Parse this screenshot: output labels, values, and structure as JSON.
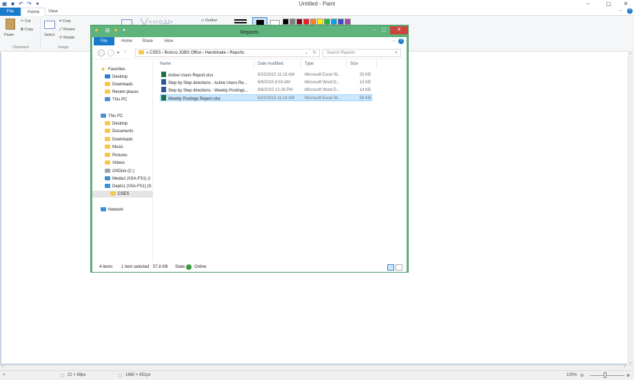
{
  "paint": {
    "title": "Untitled - Paint",
    "tabs": [
      "File",
      "Home",
      "View"
    ],
    "ribbon": {
      "paste": "Paste",
      "cut": "Cut",
      "copy": "Copy",
      "crop": "Crop",
      "resize": "Resize",
      "rotate": "Rotate",
      "select": "Select",
      "outline": "Outline",
      "groups": [
        "Clipboard",
        "Image"
      ]
    },
    "palette": [
      "#000000",
      "#7f7f7f",
      "#880015",
      "#ed1c24",
      "#ff7f27",
      "#fff200",
      "#22b14c",
      "#00a2e8",
      "#3f48cc",
      "#a349a4"
    ],
    "status": {
      "selection_size": "22 × 89px",
      "image_size": "1680 × 951px",
      "zoom": "100%"
    }
  },
  "explorer": {
    "title": "Reports",
    "tabs": [
      "File",
      "Home",
      "Share",
      "View"
    ],
    "address": "« CSES › Bronco JOBS Office › Handshake › Reports",
    "search_placeholder": "Search Reports",
    "nav": {
      "favorites": "Favorites",
      "fav_items": [
        "Desktop",
        "Downloads",
        "Recent places",
        "This PC"
      ],
      "thispc": "This PC",
      "pc_items": [
        "Desktop",
        "Documents",
        "Downloads",
        "Music",
        "Pictures",
        "Videos",
        "OSDisk (C:)",
        "Media1 (\\\\SA-FS1) (I",
        "Depts1 (\\\\SA-FS1) (S"
      ],
      "cses": "CSES",
      "network": "Network"
    },
    "columns": [
      "Name",
      "Date modified",
      "Type",
      "Size"
    ],
    "files": [
      {
        "name": "Active Users Report.xlsx",
        "date": "6/22/2015 11:15 AM",
        "type": "Microsoft Excel W...",
        "size": "20 KB",
        "kind": "xl"
      },
      {
        "name": "Step by Step directions - Active Users Re...",
        "date": "6/9/2015 8:53 AM",
        "type": "Microsoft Word D...",
        "size": "13 KB",
        "kind": "wd"
      },
      {
        "name": "Step by Step directions - Weekly Postings...",
        "date": "6/8/2015 12:26 PM",
        "type": "Microsoft Word D...",
        "size": "14 KB",
        "kind": "wd"
      },
      {
        "name": "Weekly Postings Report.xlsx",
        "date": "6/22/2015 11:14 AM",
        "type": "Microsoft Excel W...",
        "size": "58 KB",
        "kind": "xl"
      }
    ],
    "status": {
      "items": "4 items",
      "selected": "1 item selected",
      "size": "57.8 KB",
      "state_label": "State:",
      "state": "Online"
    }
  }
}
